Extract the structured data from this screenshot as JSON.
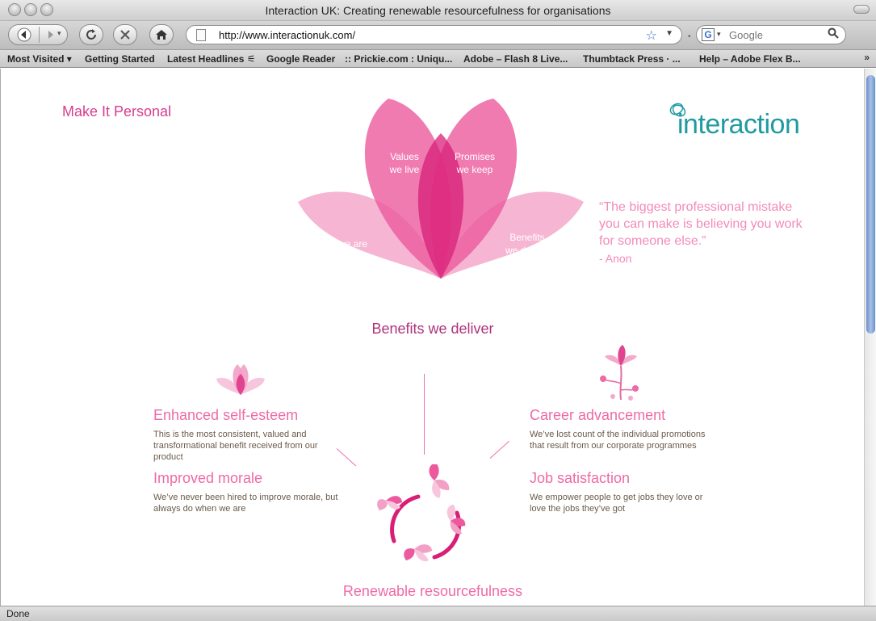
{
  "window": {
    "title": "Interaction UK: Creating renewable resourcefulness for organisations"
  },
  "navbar": {
    "url": "http://www.interactionuk.com/",
    "search_placeholder": "Google"
  },
  "bookmarks": [
    "Most Visited ▾",
    "Getting Started",
    "Latest Headlines ⚟",
    "Google Reader",
    ":: Prickie.com : Uniqu...",
    "Adobe – Flash 8 Live...",
    "Thumbtack Press  ·  ...",
    "Help – Adobe Flex B..."
  ],
  "bookmarks_more": "»",
  "status": "Done",
  "page": {
    "tagline": "Make It Personal",
    "logo_text": "interaction",
    "petals": {
      "left": "Who we are",
      "center_left_line1": "Values",
      "center_left_line2": "we live",
      "center_right_line1": "Promises",
      "center_right_line2": "we keep",
      "right_line1": "Benefits",
      "right_line2": "we deliver"
    },
    "quote": "“The biggest professional mistake you can make is believing you work for someone else.”",
    "quote_author": "- Anon",
    "benefits_heading": "Benefits we deliver",
    "benefits": [
      {
        "title": "Enhanced self-esteem",
        "text": "This is the most consistent, valued and transformational benefit received from our product"
      },
      {
        "title": "Improved morale",
        "text": "We’ve never been hired to improve morale, but always do when we are"
      },
      {
        "title": "Career advancement",
        "text": "We’ve lost count of the individual promotions that result from our corporate programmes"
      },
      {
        "title": "Job satisfaction",
        "text": "We empower people to get jobs they love or love the jobs they’ve got"
      }
    ],
    "renewable_heading": "Renewable resourcefulness"
  },
  "colors": {
    "pink_light": "#f4a9cb",
    "pink_mid": "#ec5a9d",
    "pink_dark": "#d81f78",
    "teal": "#1f9aa1"
  },
  "icons": {
    "back": "back-arrow-icon",
    "forward": "forward-arrow-icon",
    "reload": "reload-icon",
    "stop": "stop-icon",
    "home": "home-icon",
    "bookmark_star": "star-icon",
    "search": "magnifier-icon"
  }
}
